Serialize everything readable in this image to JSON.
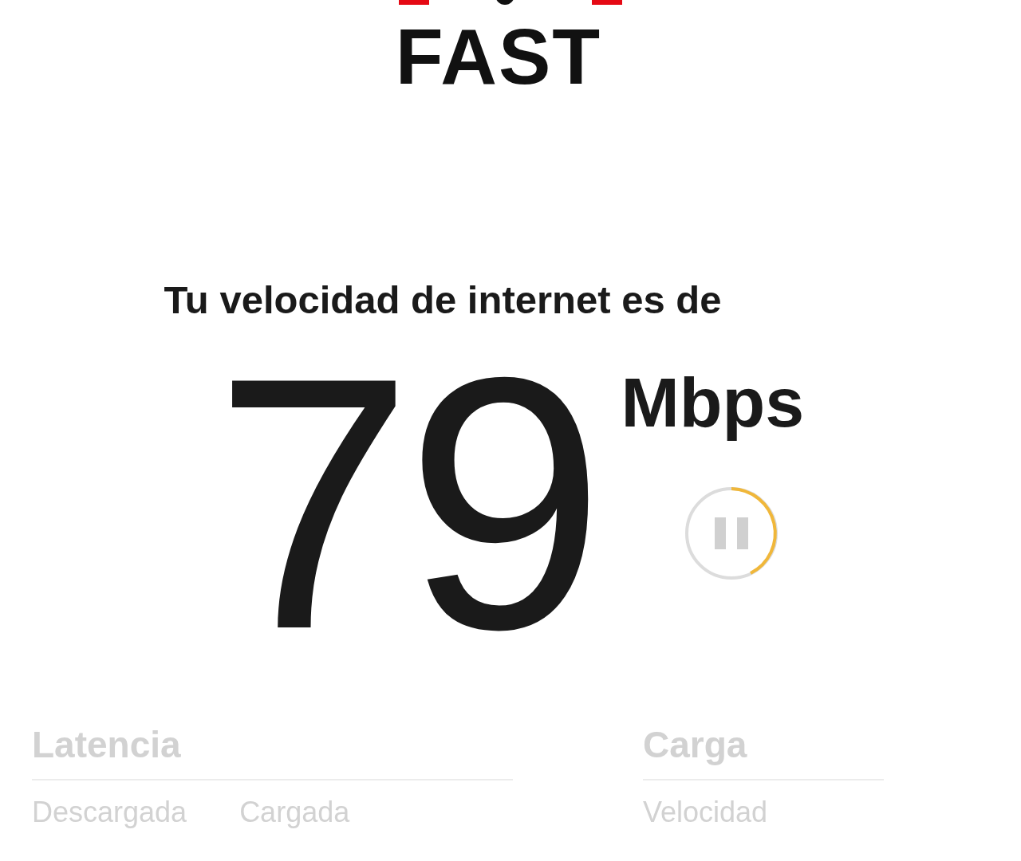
{
  "logo": {
    "text": "FAST"
  },
  "result": {
    "heading": "Tu velocidad de internet es de",
    "value": "79",
    "unit": "Mbps"
  },
  "details": [
    {
      "title": "Latencia",
      "labels": [
        "Descargada",
        "Cargada"
      ]
    },
    {
      "title": "Carga",
      "labels": [
        "Velocidad"
      ]
    }
  ]
}
